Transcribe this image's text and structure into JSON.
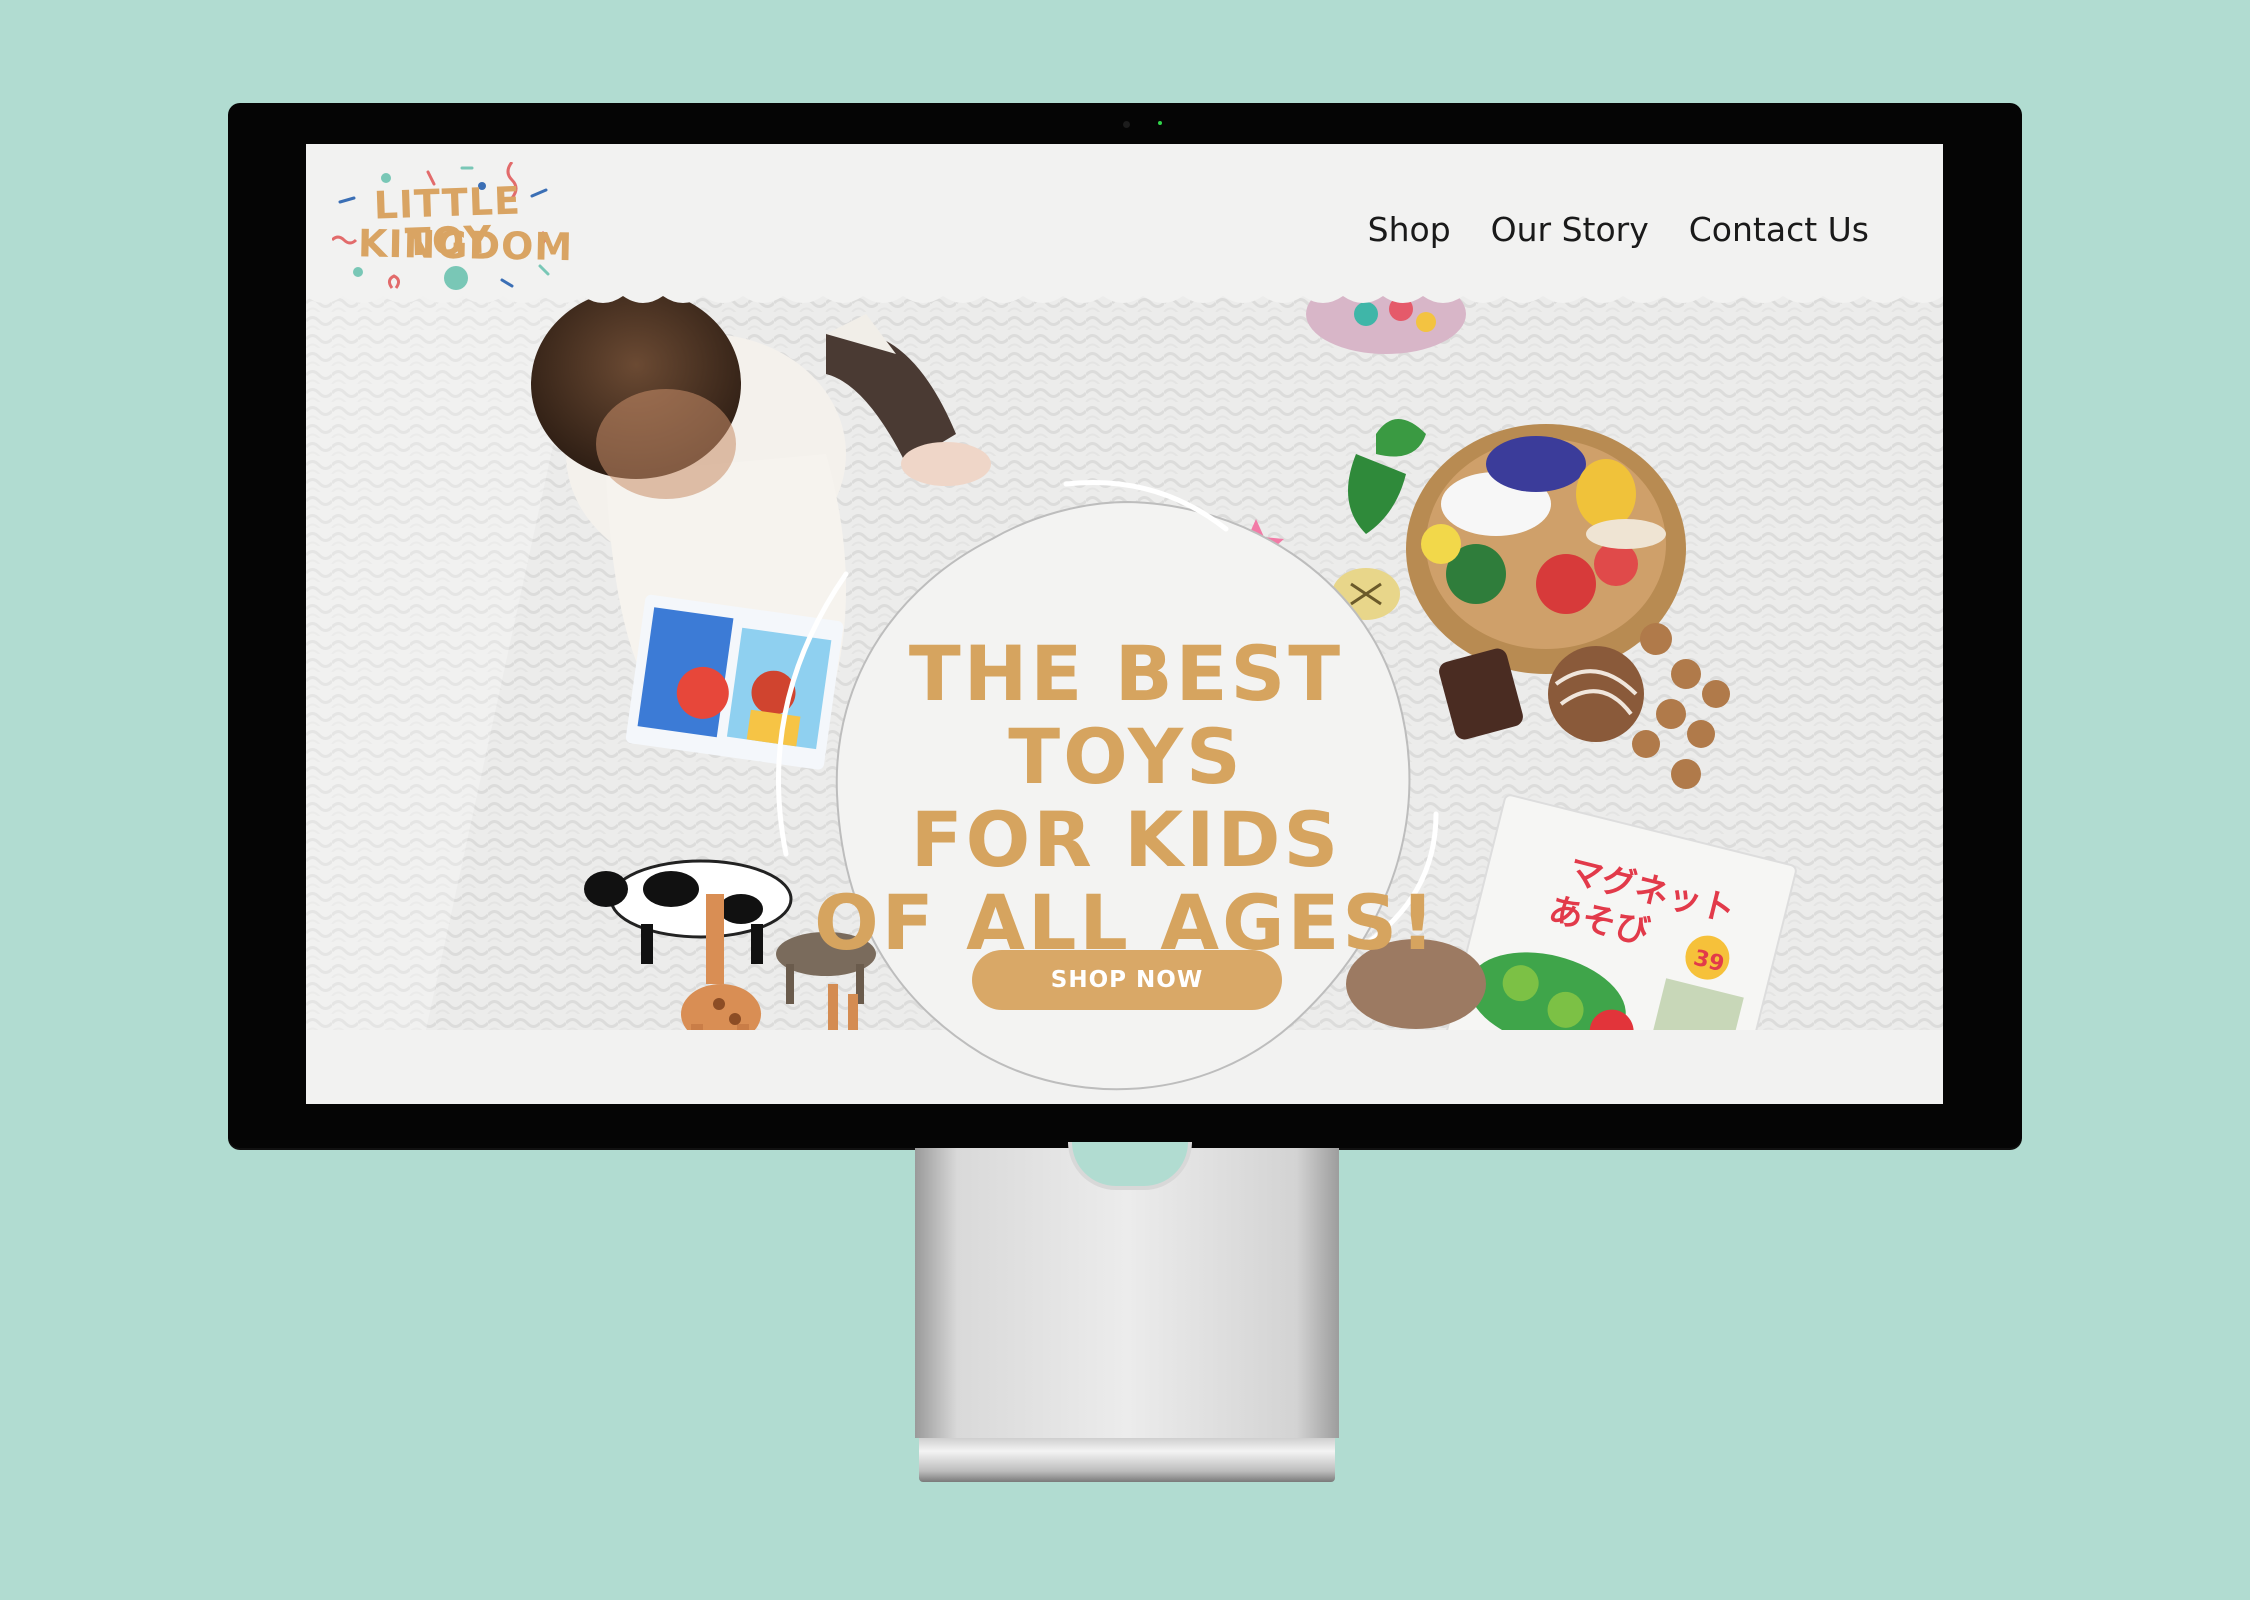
{
  "site": {
    "logo": {
      "line1": "LITTLE TOY",
      "line2": "KINGDOM"
    },
    "nav": [
      {
        "label": "Shop"
      },
      {
        "label": "Our Story"
      },
      {
        "label": "Contact Us"
      }
    ]
  },
  "hero": {
    "headline": [
      "THE BEST TOYS",
      "FOR KIDS",
      "OF ALL AGES!"
    ],
    "cta_label": "SHOP NOW",
    "book1_text": "マグネット",
    "book1_text2": "あそび",
    "book_badge": "39"
  },
  "colors": {
    "background": "#b1dcd1",
    "accent": "#d6a45f",
    "screen": "#f2f2f1",
    "bezel": "#050505"
  }
}
